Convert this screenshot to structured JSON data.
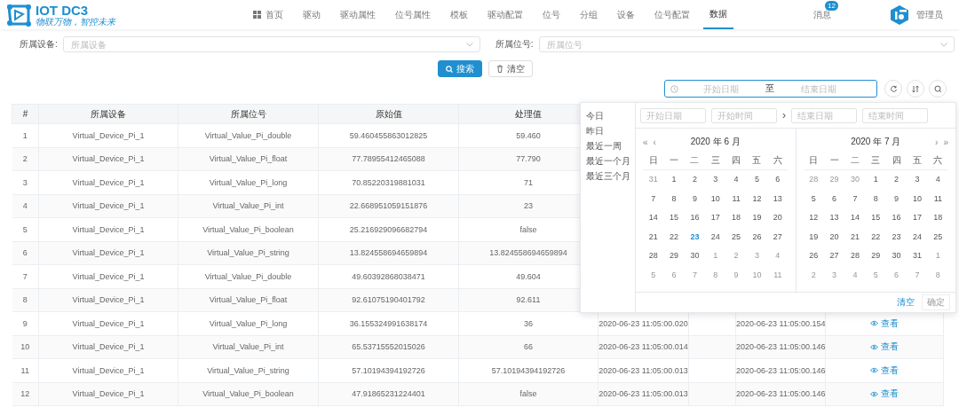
{
  "logo": {
    "title": "IOT DC3",
    "slogan": "物联万物，智控未来"
  },
  "nav": [
    {
      "label": "首页",
      "kind": "icon-link",
      "selected": false
    },
    {
      "label": "驱动",
      "kind": "link",
      "selected": false
    },
    {
      "label": "驱动属性",
      "kind": "link",
      "selected": false
    },
    {
      "label": "位号属性",
      "kind": "link",
      "selected": false
    },
    {
      "label": "模板",
      "kind": "link",
      "selected": false
    },
    {
      "label": "驱动配置",
      "kind": "link",
      "selected": false
    },
    {
      "label": "位号",
      "kind": "link",
      "selected": false
    },
    {
      "label": "分组",
      "kind": "link",
      "selected": false
    },
    {
      "label": "设备",
      "kind": "link",
      "selected": false
    },
    {
      "label": "位号配置",
      "kind": "link",
      "selected": false
    },
    {
      "label": "数据",
      "kind": "link",
      "selected": true
    }
  ],
  "messages": {
    "label": "消息",
    "badge": "12"
  },
  "user": {
    "name": "管理员"
  },
  "filters": [
    {
      "label": "所属设备:",
      "placeholder": "所属设备"
    },
    {
      "label": "所属位号:",
      "placeholder": "所属位号"
    }
  ],
  "buttons": [
    {
      "label": "搜索",
      "kind": "primary"
    },
    {
      "label": "清空",
      "kind": "default"
    }
  ],
  "date_range": {
    "start_placeholder": "开始日期",
    "separator": "至",
    "end_placeholder": "结束日期"
  },
  "toolbar": [
    {
      "kind": "refresh"
    },
    {
      "kind": "sort"
    },
    {
      "kind": "search"
    }
  ],
  "table": {
    "columns": [
      "#",
      "所属设备",
      "所属位号",
      "原始值",
      "处理值"
    ],
    "rows": [
      {
        "cells": [
          "1",
          "Virtual_Device_Pi_1",
          "Virtual_Value_Pi_double",
          "59.460455863012825",
          "59.460"
        ]
      },
      {
        "cells": [
          "2",
          "Virtual_Device_Pi_1",
          "Virtual_Value_Pi_float",
          "77.78955412465088",
          "77.790"
        ]
      },
      {
        "cells": [
          "3",
          "Virtual_Device_Pi_1",
          "Virtual_Value_Pi_long",
          "70.85220319881031",
          "71"
        ]
      },
      {
        "cells": [
          "4",
          "Virtual_Device_Pi_1",
          "Virtual_Value_Pi_int",
          "22.668951059151876",
          "23"
        ]
      },
      {
        "cells": [
          "5",
          "Virtual_Device_Pi_1",
          "Virtual_Value_Pi_boolean",
          "25.216929096682794",
          "false"
        ]
      },
      {
        "cells": [
          "6",
          "Virtual_Device_Pi_1",
          "Virtual_Value_Pi_string",
          "13.824558694659894",
          "13.824558694659894"
        ]
      },
      {
        "cells": [
          "7",
          "Virtual_Device_Pi_1",
          "Virtual_Value_Pi_double",
          "49.60392868038471",
          "49.604"
        ]
      },
      {
        "cells": [
          "8",
          "Virtual_Device_Pi_1",
          "Virtual_Value_Pi_float",
          "92.61075190401792",
          "92.611"
        ]
      },
      {
        "cells": [
          "9",
          "Virtual_Device_Pi_1",
          "Virtual_Value_Pi_long",
          "36.155324991638174",
          "36"
        ],
        "column_6": "2020-06-23 11:05:00.020",
        "column_8": "2020-06-23 11:05:00.154",
        "action": "查看"
      },
      {
        "cells": [
          "10",
          "Virtual_Device_Pi_1",
          "Virtual_Value_Pi_int",
          "65.53715552015026",
          "66"
        ],
        "column_6": "2020-06-23 11:05:00.014",
        "column_8": "2020-06-23 11:05:00.146",
        "action": "查看"
      },
      {
        "cells": [
          "11",
          "Virtual_Device_Pi_1",
          "Virtual_Value_Pi_string",
          "57.10194394192726",
          "57.10194394192726"
        ],
        "column_6": "2020-06-23 11:05:00.013",
        "column_8": "2020-06-23 11:05:00.146",
        "action": "查看"
      },
      {
        "cells": [
          "12",
          "Virtual_Device_Pi_1",
          "Virtual_Value_Pi_boolean",
          "47.91865231224401",
          "false"
        ],
        "column_6": "2020-06-23 11:05:00.013",
        "column_8": "2020-06-23 11:05:00.146",
        "action": "查看"
      }
    ]
  },
  "date_picker": {
    "shortcuts": [
      "今日",
      "昨日",
      "最近一周",
      "最近一个月",
      "最近三个月"
    ],
    "inputs": [
      {
        "placeholder": "开始日期"
      },
      {
        "placeholder": "开始时间"
      },
      {
        "placeholder": "结束日期"
      },
      {
        "placeholder": "结束时间"
      }
    ],
    "separator": "›",
    "calendars": [
      {
        "title": "2020 年 6 月",
        "nav_left": [
          "«",
          "‹"
        ],
        "weekdays": [
          "日",
          "一",
          "二",
          "三",
          "四",
          "五",
          "六"
        ],
        "weeks": [
          [
            {
              "d": "31",
              "muted": true,
              "today": false
            },
            {
              "d": "1",
              "muted": false,
              "today": false
            },
            {
              "d": "2",
              "muted": false,
              "today": false
            },
            {
              "d": "3",
              "muted": false,
              "today": false
            },
            {
              "d": "4",
              "muted": false,
              "today": false
            },
            {
              "d": "5",
              "muted": false,
              "today": false
            },
            {
              "d": "6",
              "muted": false,
              "today": false
            }
          ],
          [
            {
              "d": "7",
              "muted": false,
              "today": false
            },
            {
              "d": "8",
              "muted": false,
              "today": false
            },
            {
              "d": "9",
              "muted": false,
              "today": false
            },
            {
              "d": "10",
              "muted": false,
              "today": false
            },
            {
              "d": "11",
              "muted": false,
              "today": false
            },
            {
              "d": "12",
              "muted": false,
              "today": false
            },
            {
              "d": "13",
              "muted": false,
              "today": false
            }
          ],
          [
            {
              "d": "14",
              "muted": false,
              "today": false
            },
            {
              "d": "15",
              "muted": false,
              "today": false
            },
            {
              "d": "16",
              "muted": false,
              "today": false
            },
            {
              "d": "17",
              "muted": false,
              "today": false
            },
            {
              "d": "18",
              "muted": false,
              "today": false
            },
            {
              "d": "19",
              "muted": false,
              "today": false
            },
            {
              "d": "20",
              "muted": false,
              "today": false
            }
          ],
          [
            {
              "d": "21",
              "muted": false,
              "today": false
            },
            {
              "d": "22",
              "muted": false,
              "today": false
            },
            {
              "d": "23",
              "muted": false,
              "today": true
            },
            {
              "d": "24",
              "muted": false,
              "today": false
            },
            {
              "d": "25",
              "muted": false,
              "today": false
            },
            {
              "d": "26",
              "muted": false,
              "today": false
            },
            {
              "d": "27",
              "muted": false,
              "today": false
            }
          ],
          [
            {
              "d": "28",
              "muted": false,
              "today": false
            },
            {
              "d": "29",
              "muted": false,
              "today": false
            },
            {
              "d": "30",
              "muted": false,
              "today": false
            },
            {
              "d": "1",
              "muted": true,
              "today": false
            },
            {
              "d": "2",
              "muted": true,
              "today": false
            },
            {
              "d": "3",
              "muted": true,
              "today": false
            },
            {
              "d": "4",
              "muted": true,
              "today": false
            }
          ],
          [
            {
              "d": "5",
              "muted": true,
              "today": false
            },
            {
              "d": "6",
              "muted": true,
              "today": false
            },
            {
              "d": "7",
              "muted": true,
              "today": false
            },
            {
              "d": "8",
              "muted": true,
              "today": false
            },
            {
              "d": "9",
              "muted": true,
              "today": false
            },
            {
              "d": "10",
              "muted": true,
              "today": false
            },
            {
              "d": "11",
              "muted": true,
              "today": false
            }
          ]
        ]
      },
      {
        "title": "2020 年 7 月",
        "nav_right": [
          "›",
          "»"
        ],
        "weekdays": [
          "日",
          "一",
          "二",
          "三",
          "四",
          "五",
          "六"
        ],
        "weeks": [
          [
            {
              "d": "28",
              "muted": true,
              "today": false
            },
            {
              "d": "29",
              "muted": true,
              "today": false
            },
            {
              "d": "30",
              "muted": true,
              "today": false
            },
            {
              "d": "1",
              "muted": false,
              "today": false
            },
            {
              "d": "2",
              "muted": false,
              "today": false
            },
            {
              "d": "3",
              "muted": false,
              "today": false
            },
            {
              "d": "4",
              "muted": false,
              "today": false
            }
          ],
          [
            {
              "d": "5",
              "muted": false,
              "today": false
            },
            {
              "d": "6",
              "muted": false,
              "today": false
            },
            {
              "d": "7",
              "muted": false,
              "today": false
            },
            {
              "d": "8",
              "muted": false,
              "today": false
            },
            {
              "d": "9",
              "muted": false,
              "today": false
            },
            {
              "d": "10",
              "muted": false,
              "today": false
            },
            {
              "d": "11",
              "muted": false,
              "today": false
            }
          ],
          [
            {
              "d": "12",
              "muted": false,
              "today": false
            },
            {
              "d": "13",
              "muted": false,
              "today": false
            },
            {
              "d": "14",
              "muted": false,
              "today": false
            },
            {
              "d": "15",
              "muted": false,
              "today": false
            },
            {
              "d": "16",
              "muted": false,
              "today": false
            },
            {
              "d": "17",
              "muted": false,
              "today": false
            },
            {
              "d": "18",
              "muted": false,
              "today": false
            }
          ],
          [
            {
              "d": "19",
              "muted": false,
              "today": false
            },
            {
              "d": "20",
              "muted": false,
              "today": false
            },
            {
              "d": "21",
              "muted": false,
              "today": false
            },
            {
              "d": "22",
              "muted": false,
              "today": false
            },
            {
              "d": "23",
              "muted": false,
              "today": false
            },
            {
              "d": "24",
              "muted": false,
              "today": false
            },
            {
              "d": "25",
              "muted": false,
              "today": false
            }
          ],
          [
            {
              "d": "26",
              "muted": false,
              "today": false
            },
            {
              "d": "27",
              "muted": false,
              "today": false
            },
            {
              "d": "28",
              "muted": false,
              "today": false
            },
            {
              "d": "29",
              "muted": false,
              "today": false
            },
            {
              "d": "30",
              "muted": false,
              "today": false
            },
            {
              "d": "31",
              "muted": false,
              "today": false
            },
            {
              "d": "1",
              "muted": true,
              "today": false
            }
          ],
          [
            {
              "d": "2",
              "muted": true,
              "today": false
            },
            {
              "d": "3",
              "muted": true,
              "today": false
            },
            {
              "d": "4",
              "muted": true,
              "today": false
            },
            {
              "d": "5",
              "muted": true,
              "today": false
            },
            {
              "d": "6",
              "muted": true,
              "today": false
            },
            {
              "d": "7",
              "muted": true,
              "today": false
            },
            {
              "d": "8",
              "muted": true,
              "today": false
            }
          ]
        ]
      }
    ],
    "footer": {
      "clear": "清空",
      "confirm": {
        "label": "确定",
        "disabled": true
      }
    }
  }
}
